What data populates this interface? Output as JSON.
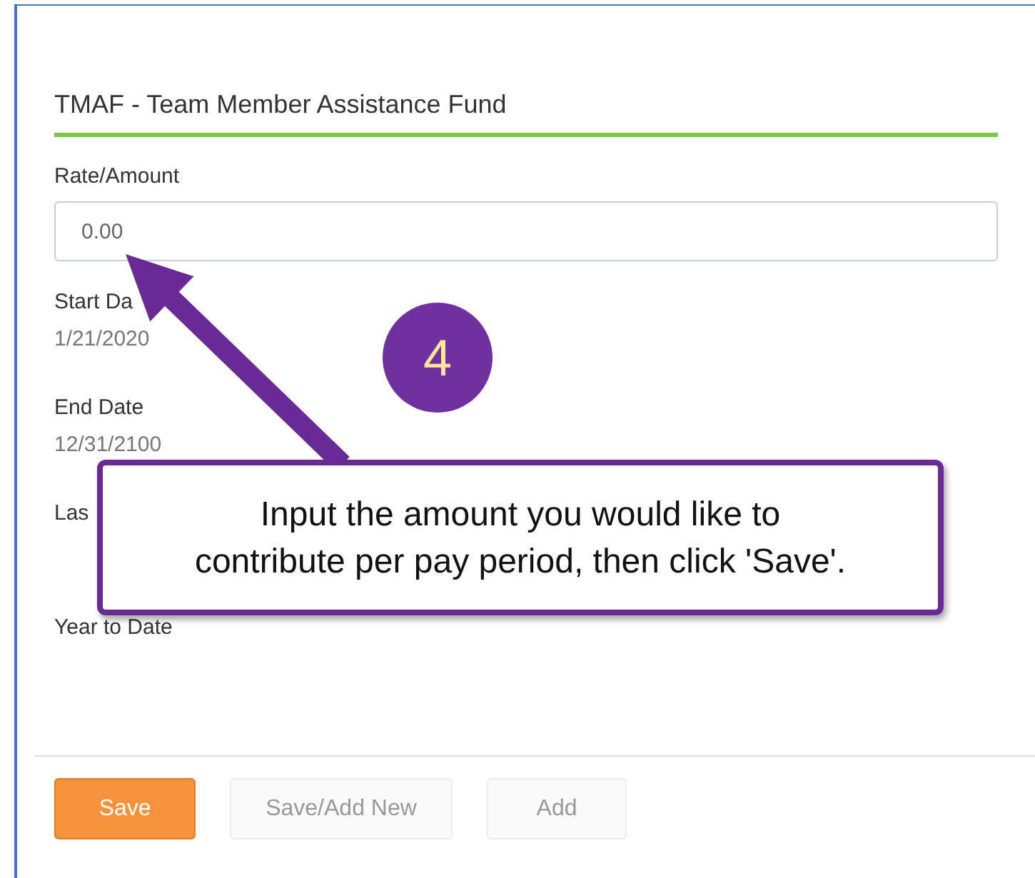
{
  "section_title": "TMAF - Team Member Assistance Fund",
  "amount_field": {
    "label": "Rate/Amount",
    "value": "0.00"
  },
  "fields": [
    {
      "label": "Start Da",
      "value": "1/21/2020"
    },
    {
      "label": "End Date",
      "value": "12/31/2100"
    },
    {
      "label": "Las"
    },
    {
      "label": "Year to Date"
    }
  ],
  "buttons": [
    {
      "label": "Save",
      "kind": "primary",
      "disabled": false
    },
    {
      "label": "Save/Add New",
      "kind": "secondary",
      "disabled": true
    },
    {
      "label": "Add",
      "kind": "secondary",
      "disabled": true
    }
  ],
  "step_badge": "4",
  "callout": "Input the amount you would like to contribute per pay period, then click 'Save'."
}
